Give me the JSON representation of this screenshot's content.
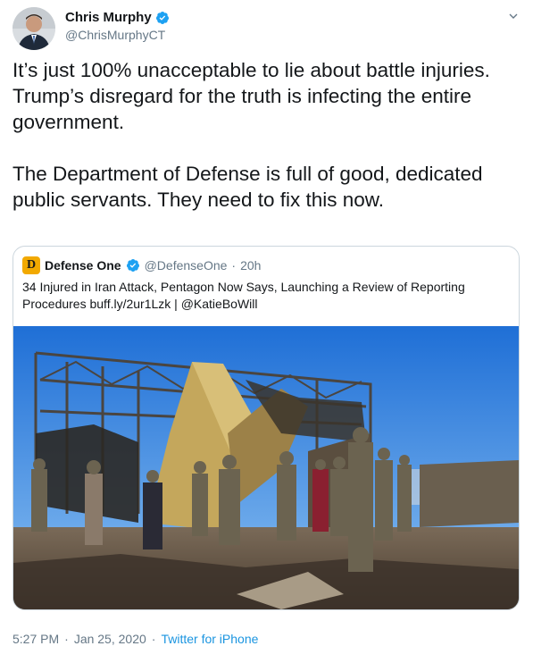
{
  "author": {
    "name": "Chris Murphy",
    "handle": "@ChrisMurphyCT",
    "verified": true,
    "avatar_icon": "person-avatar-icon"
  },
  "tweet": {
    "text": "It’s just 100% unacceptable to lie about battle injuries. Trump’s disregard for the truth is infecting the entire government.\n\nThe Department of Defense is full of good, dedicated public servants. They need to fix this now."
  },
  "quote": {
    "logo_letter": "D",
    "name": "Defense One",
    "handle": "@DefenseOne",
    "separator": "·",
    "time": "20h",
    "text": "34 Injured in Iran Attack, Pentagon Now Says, Launching a Review of Reporting Procedures buff.ly/2ur1Lzk | @KatieBoWill",
    "image_alt_icon": "damaged-structure-photo"
  },
  "footer": {
    "time": "5:27 PM",
    "separator": "·",
    "date": "Jan 25, 2020",
    "source": "Twitter for iPhone"
  },
  "colors": {
    "accent": "#1da1f2",
    "text": "#14171a",
    "muted": "#657786",
    "border": "#ccd6dd",
    "logo": "#f2a900"
  }
}
